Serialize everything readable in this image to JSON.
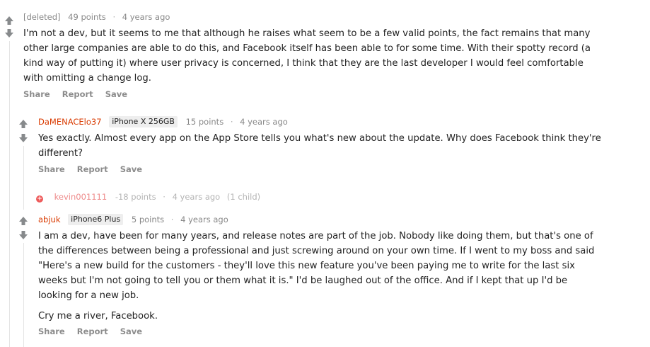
{
  "comments": [
    {
      "author": "[deleted]",
      "flair": "",
      "points": "49 points",
      "separator": "·",
      "time": "4 years ago",
      "paragraphs": [
        "I'm not a dev, but it seems to me that although he raises what seem to be a few valid points, the fact remains that many other large companies are able to do this, and Facebook itself has been able to for some time. With their spotty record (a kind way of putting it) where user privacy is concerned, I think that they are the last developer I would feel comfortable with omitting a change log."
      ],
      "actions": [
        "Share",
        "Report",
        "Save"
      ]
    },
    {
      "author": "DaMENACElo37",
      "flair": "iPhone X 256GB",
      "points": "15 points",
      "separator": "·",
      "time": "4 years ago",
      "paragraphs": [
        "Yes exactly. Almost every app on the App Store tells you what's new about the update. Why does Facebook think they're different?"
      ],
      "actions": [
        "Share",
        "Report",
        "Save"
      ]
    },
    {
      "author": "abjuk",
      "flair": "iPhone6 Plus",
      "points": "5 points",
      "separator": "·",
      "time": "4 years ago",
      "paragraphs": [
        "I am a dev, have been for many years, and release notes are part of the job. Nobody like doing them, but that's one of the differences between being a professional and just screwing around on your own time. If I went to my boss and said \"Here's a new build for the customers - they'll love this new feature you've been paying me to write for the last six weeks but I'm not going to tell you or them what it is.\" I'd be laughed out of the office. And if I kept that up I'd be looking for a new job.",
        "Cry me a river, Facebook."
      ],
      "actions": [
        "Share",
        "Report",
        "Save"
      ]
    }
  ],
  "collapsed_comment": {
    "expand_symbol": "+",
    "author": "kevin001111",
    "points": "-18 points",
    "separator": "·",
    "time": "4 years ago",
    "children": "(1 child)"
  },
  "colors": {
    "author_red": "#d93a00",
    "arrow_gray": "#878a8c",
    "collapsed_author": "#ee8a8a",
    "thread_line": "#e3e3e3"
  }
}
